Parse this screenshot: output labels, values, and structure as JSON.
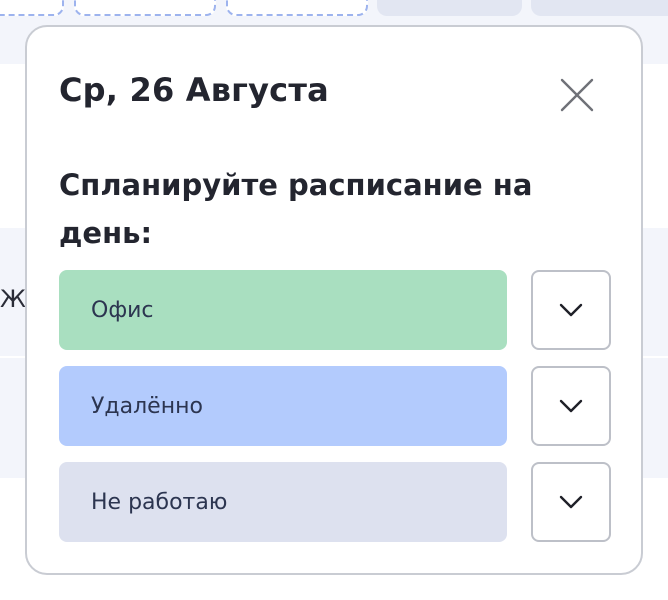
{
  "popover": {
    "title": "Ср, 26 Августа",
    "subtitle": "Спланируйте расписание на день:",
    "close_icon": "close-icon",
    "options": [
      {
        "label": "Офис",
        "color": "#a9dfc0",
        "dropdown_icon": "chevron-down-icon"
      },
      {
        "label": "Удалённо",
        "color": "#b3cbfd",
        "dropdown_icon": "chevron-down-icon"
      },
      {
        "label": "Не работаю",
        "color": "#dde1ef",
        "dropdown_icon": "chevron-down-icon"
      }
    ]
  },
  "background": {
    "partial_text": "ЖМ"
  }
}
